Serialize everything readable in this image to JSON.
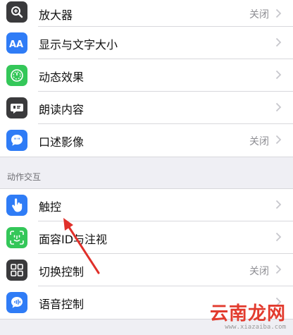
{
  "group1": {
    "items": [
      {
        "label": "放大器",
        "value": "关闭",
        "icon": "magnifier-icon",
        "icon_color": "#3a3a3c"
      },
      {
        "label": "显示与文字大小",
        "value": "",
        "icon": "text-size-icon",
        "icon_color": "#2f7cf6"
      },
      {
        "label": "动态效果",
        "value": "",
        "icon": "motion-icon",
        "icon_color": "#34c759"
      },
      {
        "label": "朗读内容",
        "value": "",
        "icon": "speak-icon",
        "icon_color": "#3a3a3c"
      },
      {
        "label": "口述影像",
        "value": "关闭",
        "icon": "audio-description-icon",
        "icon_color": "#2f7cf6"
      }
    ]
  },
  "section2": {
    "header": "动作交互",
    "items": [
      {
        "label": "触控",
        "value": "",
        "icon": "touch-hand-icon",
        "icon_color": "#2f7cf6"
      },
      {
        "label": "面容ID与注视",
        "value": "",
        "icon": "face-id-icon",
        "icon_color": "#34c759"
      },
      {
        "label": "切换控制",
        "value": "关闭",
        "icon": "switch-control-icon",
        "icon_color": "#3a3a3c"
      },
      {
        "label": "语音控制",
        "value": "",
        "icon": "voice-control-icon",
        "icon_color": "#2f7cf6"
      }
    ]
  },
  "watermark": {
    "main": "云南龙网",
    "url": "www.xiazaiba.com"
  },
  "colors": {
    "background": "#efeff4",
    "chevron": "#c7c7cc",
    "annotation_arrow": "#e0302a"
  }
}
